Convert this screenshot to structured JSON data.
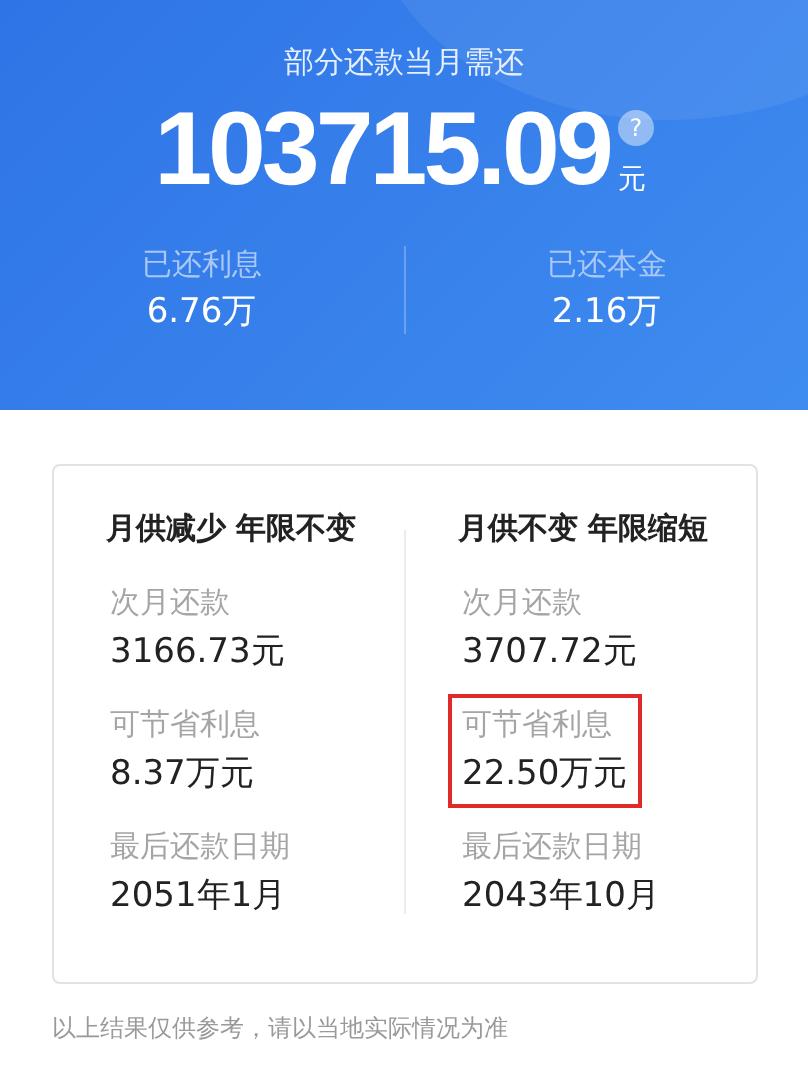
{
  "header": {
    "title": "部分还款当月需还",
    "amount": "103715.09",
    "help_icon": "?",
    "unit": "元",
    "stats": [
      {
        "label": "已还利息",
        "value": "6.76万"
      },
      {
        "label": "已还本金",
        "value": "2.16万"
      }
    ]
  },
  "options": [
    {
      "title": "月供减少 年限不变",
      "items": [
        {
          "label": "次月还款",
          "value": "3166.73元",
          "highlighted": false
        },
        {
          "label": "可节省利息",
          "value": "8.37万元",
          "highlighted": false
        },
        {
          "label": "最后还款日期",
          "value": "2051年1月",
          "highlighted": false
        }
      ]
    },
    {
      "title": "月供不变 年限缩短",
      "items": [
        {
          "label": "次月还款",
          "value": "3707.72元",
          "highlighted": false
        },
        {
          "label": "可节省利息",
          "value": "22.50万元",
          "highlighted": true
        },
        {
          "label": "最后还款日期",
          "value": "2043年10月",
          "highlighted": false
        }
      ]
    }
  ],
  "footnote": "以上结果仅供参考，请以当地实际情况为准"
}
